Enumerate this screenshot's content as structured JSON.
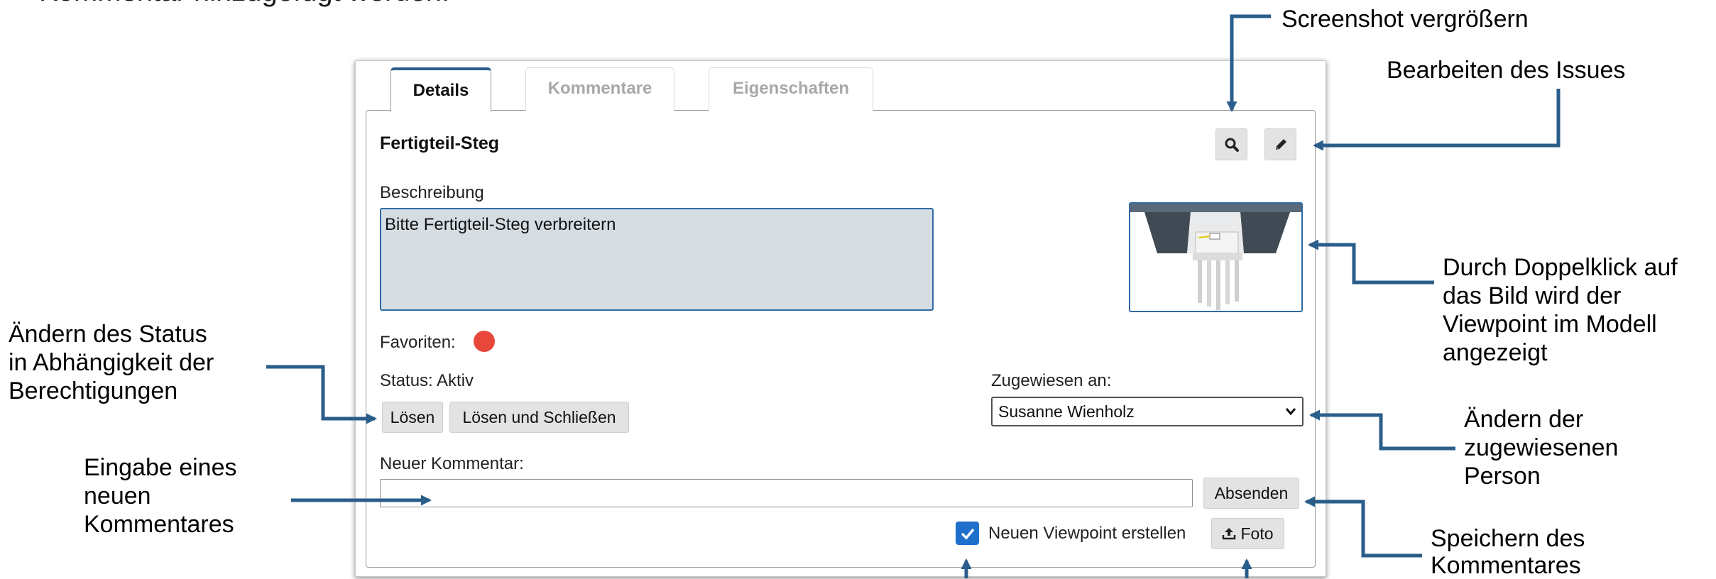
{
  "top_text": "Kommentar hinzugefügt werden.",
  "tabs": [
    {
      "label": "Details",
      "active": true
    },
    {
      "label": "Kommentare",
      "active": false
    },
    {
      "label": "Eigenschaften",
      "active": false
    }
  ],
  "issue": {
    "title": "Fertigteil-Steg",
    "description_label": "Beschreibung",
    "description_value": "Bitte Fertigteil-Steg verbreitern",
    "favorites_label": "Favoriten:",
    "favorite_color": "#e8473b",
    "status_text": "Status: Aktiv",
    "assigned_label": "Zugewiesen an:",
    "assigned_value": "Susanne Wienholz",
    "new_comment_label": "Neuer Kommentar:",
    "new_comment_value": "",
    "viewpoint_checkbox_label": "Neuen Viewpoint erstellen",
    "viewpoint_checked": true
  },
  "buttons": {
    "resolve": "Lösen",
    "resolve_close": "Lösen und Schließen",
    "send": "Absenden",
    "photo": "Foto"
  },
  "icons": {
    "zoom": "magnifier-icon",
    "edit": "pencil-icon",
    "upload": "upload-icon",
    "check": "checkmark-icon",
    "dropdown": "chevron-down-icon"
  },
  "annotations": {
    "screenshot": "Screenshot vergrößern",
    "edit": "Bearbeiten des Issues",
    "viewpoint_l1": "Durch Doppelklick auf",
    "viewpoint_l2": "das Bild wird der",
    "viewpoint_l3": "Viewpoint im Modell",
    "viewpoint_l4": "angezeigt",
    "status_l1": "Ändern des Status",
    "status_l2": "in Abhängigkeit der",
    "status_l3": "Berechtigungen",
    "assign_l1": "Ändern der",
    "assign_l2": "zugewiesenen",
    "assign_l3": "Person",
    "comment_l1": "Eingabe eines",
    "comment_l2": "neuen",
    "comment_l3": "Kommentares",
    "save_l1": "Speichern des",
    "save_l2": "Kommentares"
  },
  "colors": {
    "accent": "#2a5d8a",
    "arrow": "#2a5d8a",
    "description_bg": "#d5dde3",
    "checkbox": "#1f6fcc"
  }
}
